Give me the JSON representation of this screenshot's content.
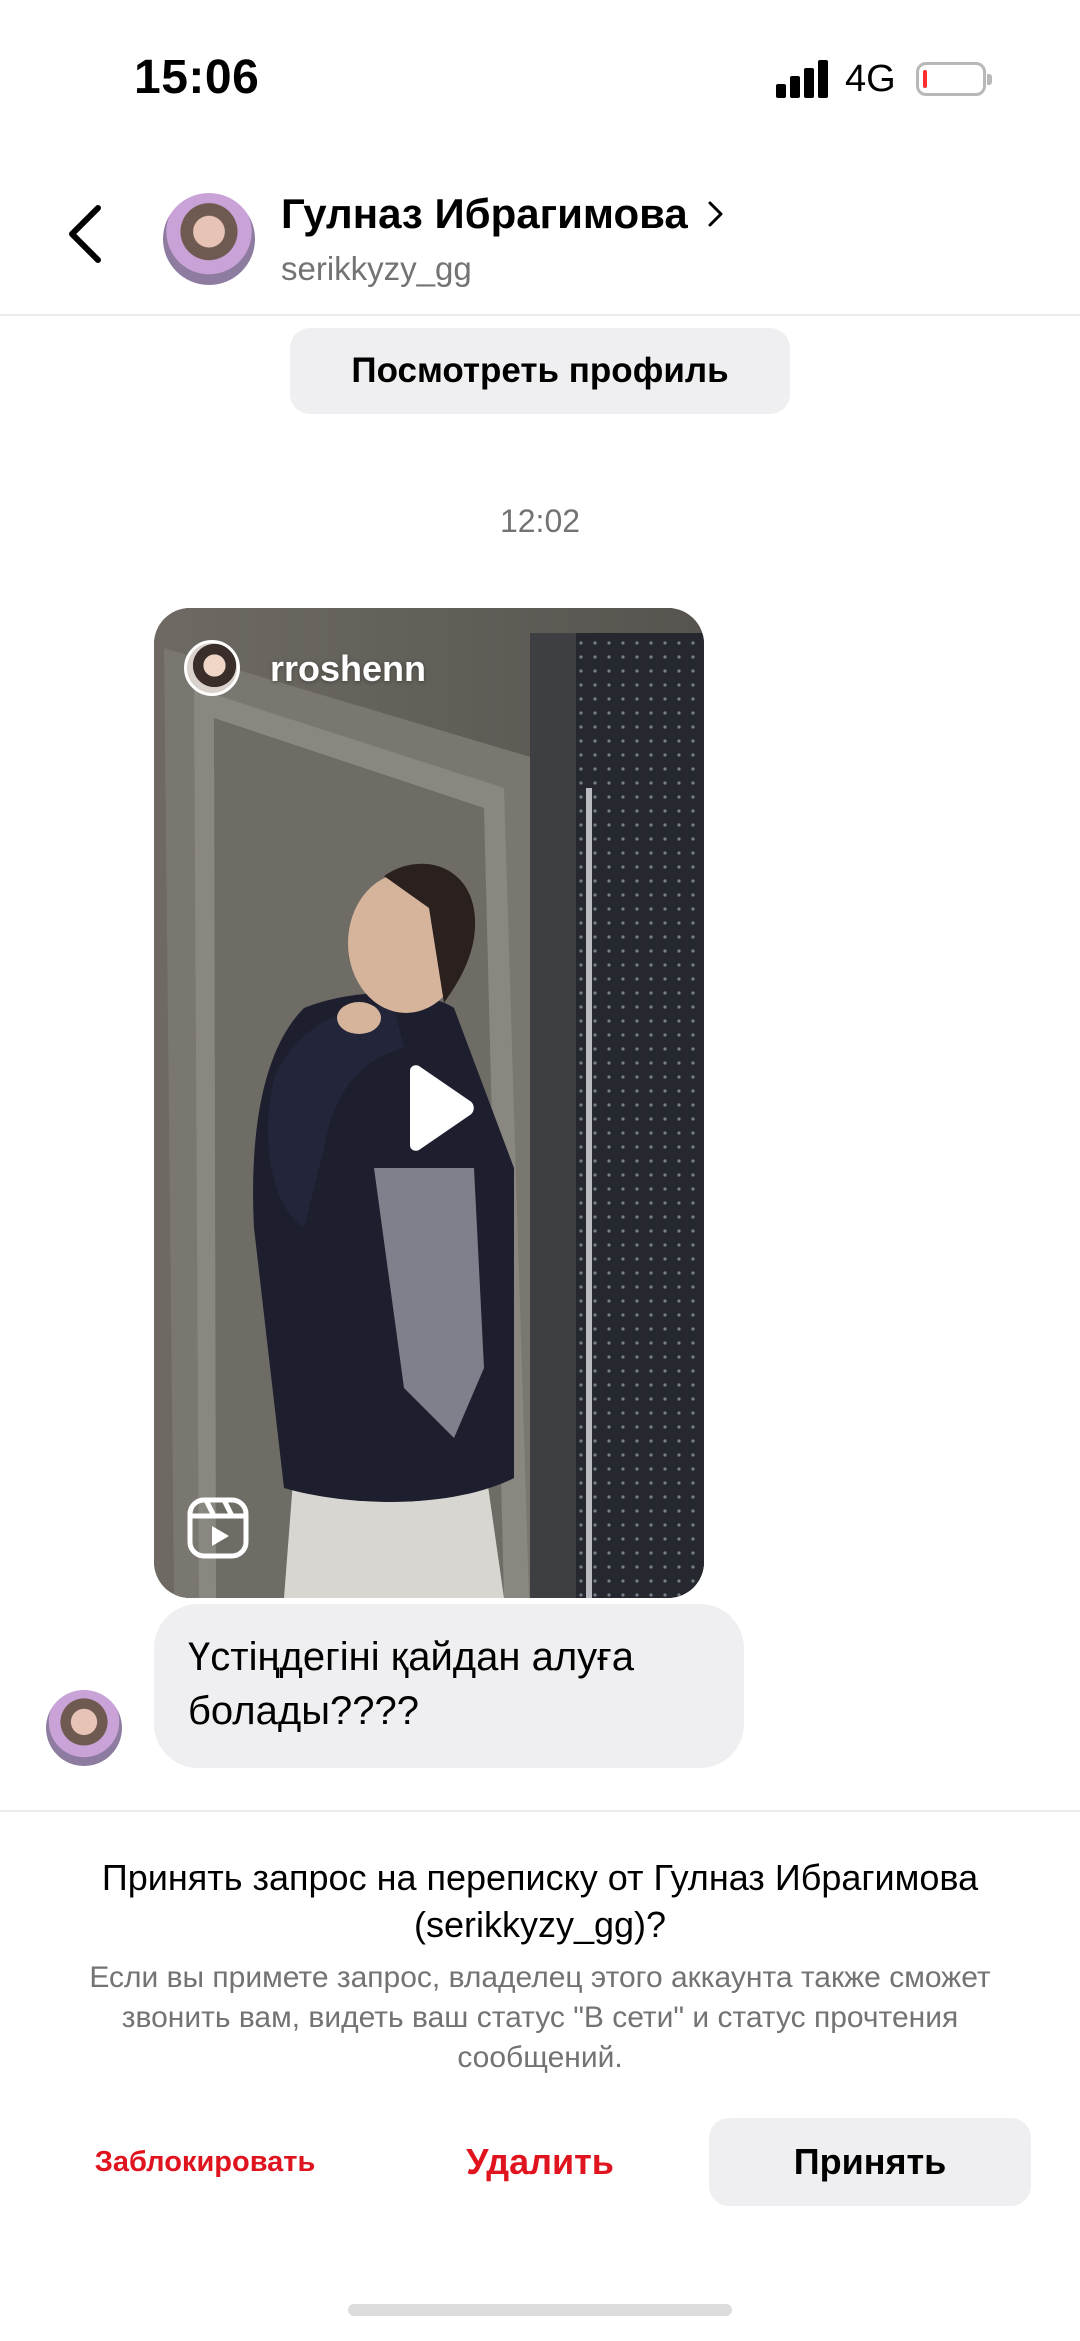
{
  "status_bar": {
    "time": "15:06",
    "network": "4G",
    "battery_level": 0.05
  },
  "header": {
    "name": "Гулназ Ибрагимова",
    "username": "serikkyzy_gg",
    "back_icon": "chevron-left-icon",
    "open_icon": "chevron-right-icon"
  },
  "view_profile_label": "Посмотреть профиль",
  "timestamp": "12:02",
  "reel": {
    "author": "rroshenn",
    "play_icon": "play-icon",
    "type_icon": "reels-icon"
  },
  "message": {
    "text": "Үстіңдегіні қайдан алуға болады????"
  },
  "request": {
    "title": "Принять запрос на переписку от Гулназ Ибрагимова (serikkyzy_gg)?",
    "description": "Если вы примете запрос, владелец этого аккаунта также сможет звонить вам, видеть ваш статус \"В сети\" и статус прочтения сообщений.",
    "block_label": "Заблокировать",
    "delete_label": "Удалить",
    "accept_label": "Принять"
  },
  "colors": {
    "danger": "#e0141e",
    "muted_text": "#737373",
    "bubble_bg": "#efeff1"
  }
}
